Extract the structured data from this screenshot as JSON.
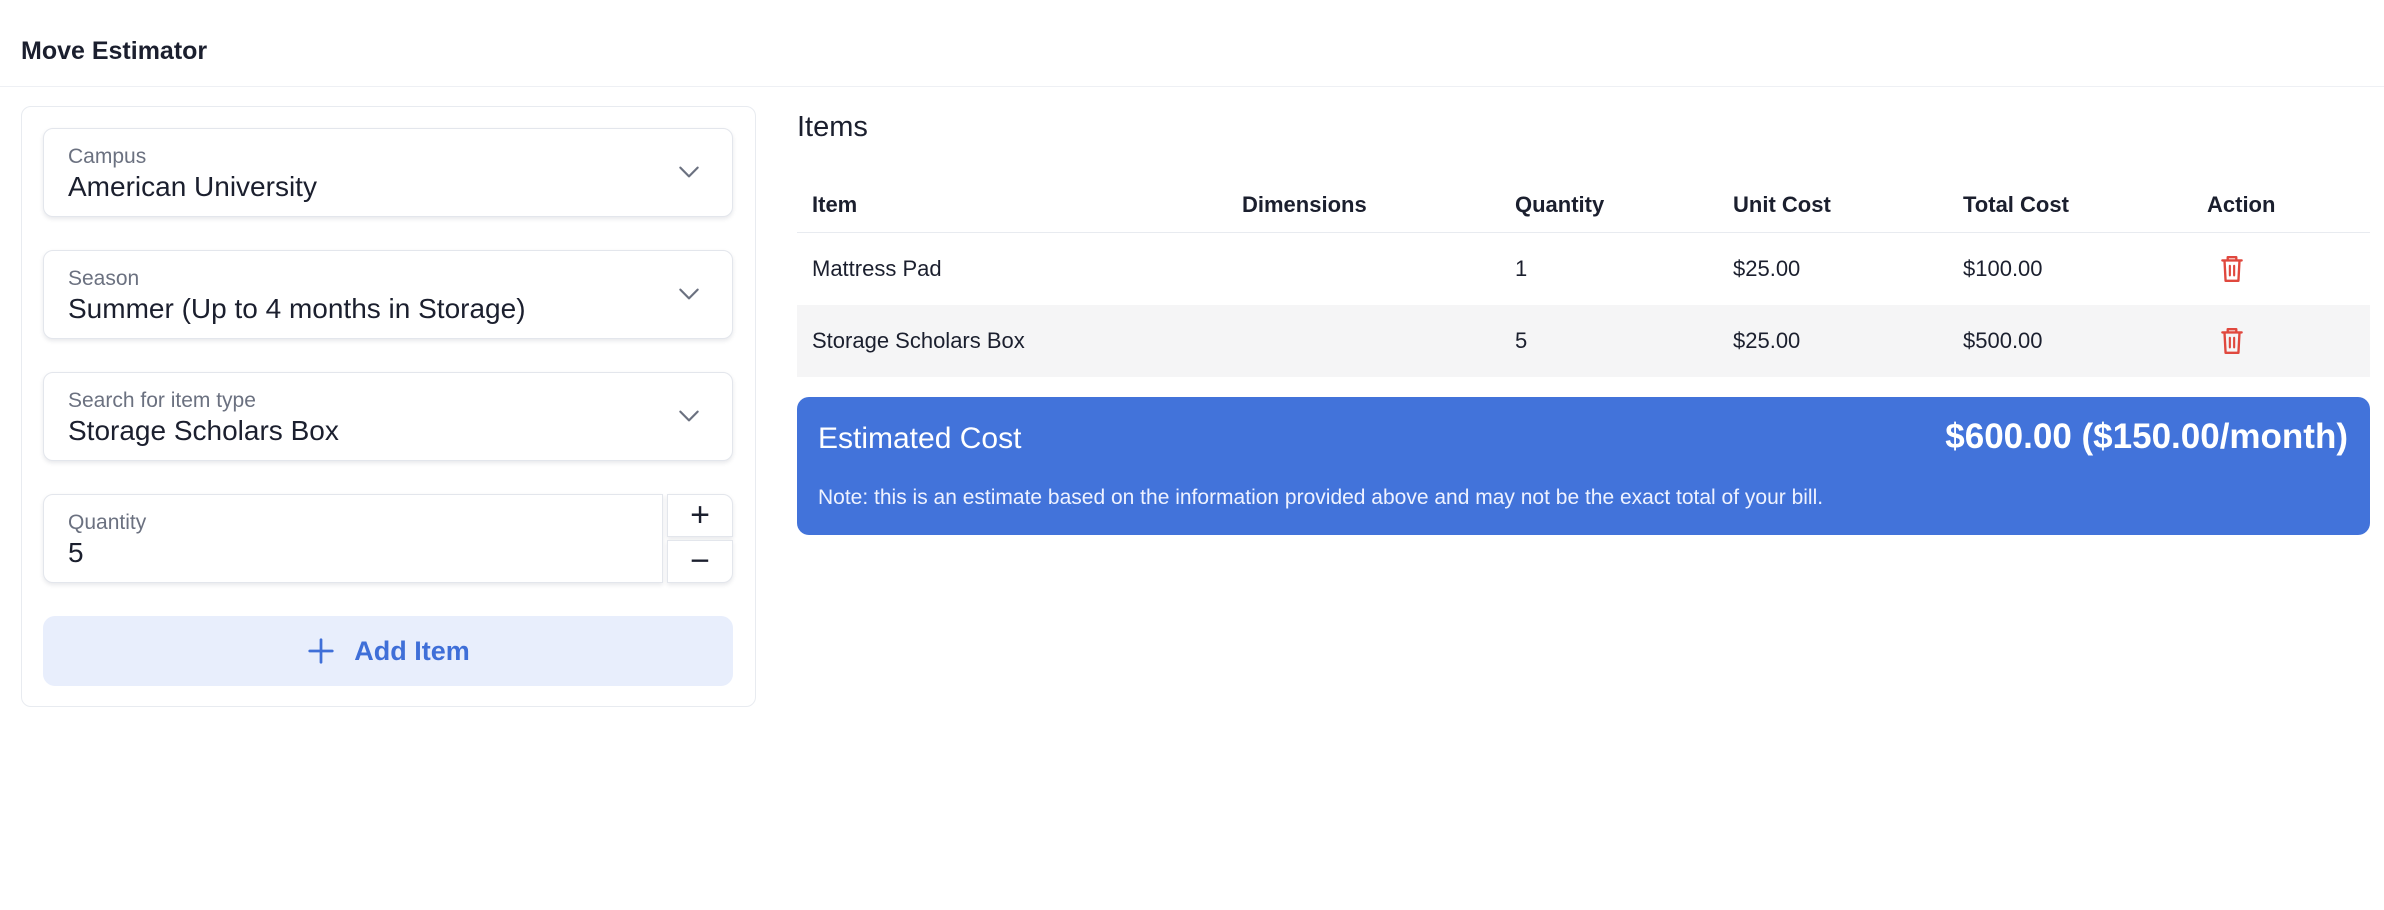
{
  "app": {
    "title": "Move Estimator"
  },
  "form": {
    "campus": {
      "label": "Campus",
      "value": "American University"
    },
    "season": {
      "label": "Season",
      "value": "Summer (Up to 4 months in Storage)"
    },
    "item_type": {
      "label": "Search for item type",
      "value": "Storage Scholars Box"
    },
    "quantity": {
      "label": "Quantity",
      "value": "5",
      "increment": "+",
      "decrement": "−"
    },
    "add_button": {
      "label": "Add Item",
      "icon": "plus-icon"
    }
  },
  "items": {
    "heading": "Items",
    "columns": [
      "Item",
      "Dimensions",
      "Quantity",
      "Unit Cost",
      "Total Cost",
      "Action"
    ],
    "rows": [
      {
        "item": "Mattress Pad",
        "dimensions": "",
        "quantity": "1",
        "unit_cost": "$25.00",
        "total_cost": "$100.00",
        "action_icon": "trash-icon"
      },
      {
        "item": "Storage Scholars Box",
        "dimensions": "",
        "quantity": "5",
        "unit_cost": "$25.00",
        "total_cost": "$500.00",
        "action_icon": "trash-icon"
      }
    ]
  },
  "estimate": {
    "label": "Estimated Cost",
    "total": "$600.00 ($150.00/month)",
    "note": "Note: this is an estimate based on the information provided above and may not be the exact total of your bill."
  },
  "colors": {
    "accent": "#4273da",
    "add_button_bg": "#e8eefc",
    "add_button_text": "#3f6fd8",
    "delete": "#e0483e"
  }
}
